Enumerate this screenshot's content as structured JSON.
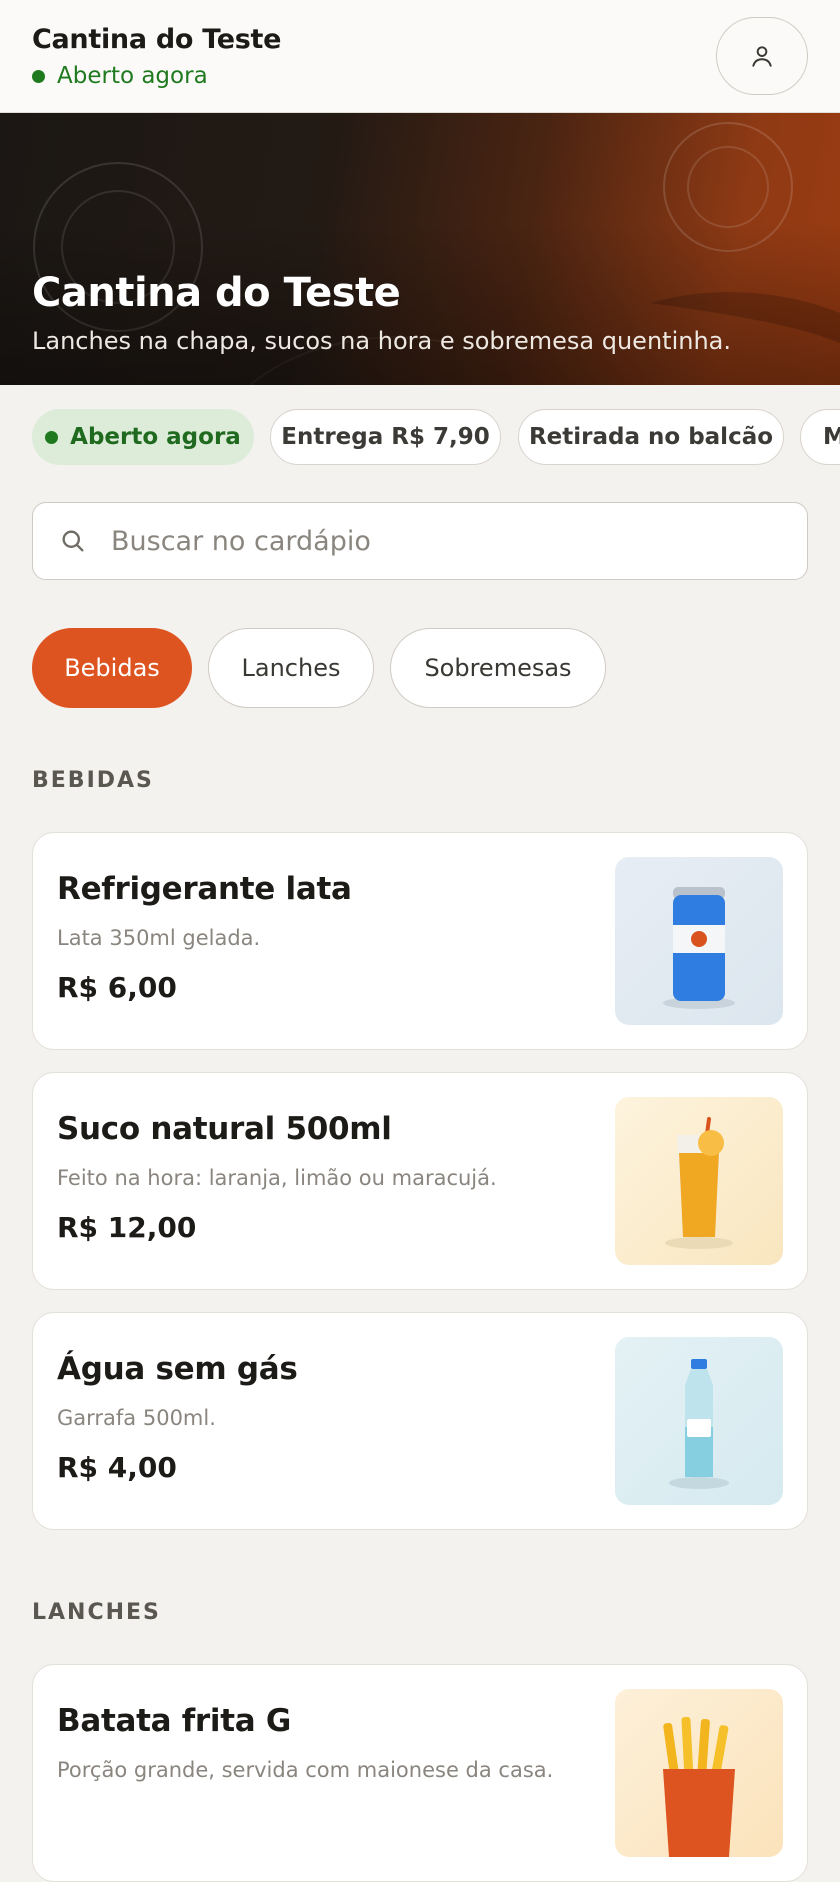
{
  "header": {
    "title": "Cantina do Teste",
    "status": "Aberto agora"
  },
  "hero": {
    "title": "Cantina do Teste",
    "subtitle": "Lanches na chapa, sucos na hora e sobremesa quentinha."
  },
  "info_chips": [
    "Aberto agora",
    "Entrega R$ 7,90",
    "Retirada no balcão",
    "M"
  ],
  "search": {
    "placeholder": "Buscar no cardápio"
  },
  "categories": [
    {
      "label": "Bebidas",
      "active": true
    },
    {
      "label": "Lanches",
      "active": false
    },
    {
      "label": "Sobremesas",
      "active": false
    }
  ],
  "sections": [
    {
      "label": "BEBIDAS",
      "items": [
        {
          "name": "Refrigerante lata",
          "description": "Lata 350ml gelada.",
          "price": "R$ 6,00",
          "icon": "soda-can-icon"
        },
        {
          "name": "Suco natural 500ml",
          "description": "Feito na hora: laranja, limão ou maracujá.",
          "price": "R$ 12,00",
          "icon": "juice-glass-icon"
        },
        {
          "name": "Água sem gás",
          "description": "Garrafa 500ml.",
          "price": "R$ 4,00",
          "icon": "water-bottle-icon"
        }
      ]
    },
    {
      "label": "LANCHES",
      "items": [
        {
          "name": "Batata frita G",
          "description": "Porção grande, servida com maionese da casa.",
          "price": "",
          "icon": "french-fries-icon"
        }
      ]
    }
  ],
  "colors": {
    "accent": "#de5420",
    "open_green": "#1f7a1f",
    "background": "#f3f2ef"
  }
}
